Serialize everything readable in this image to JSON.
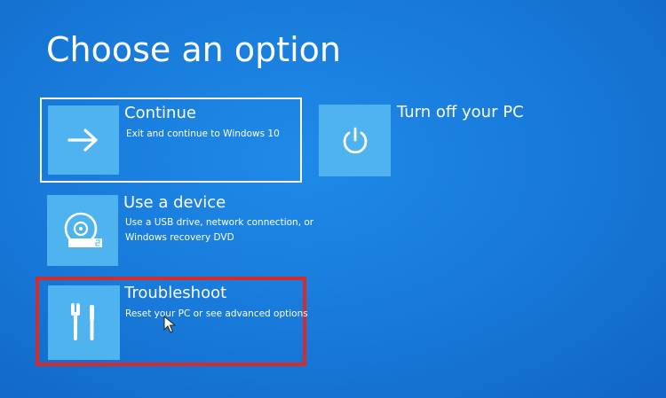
{
  "screen": {
    "title": "Choose an option",
    "background_color": "#1778d8",
    "tile_color": "#4fb3ef",
    "highlight_color": "#d42c2c"
  },
  "options": {
    "continue": {
      "title": "Continue",
      "description": "Exit and continue to Windows 10",
      "icon": "arrow-right-icon",
      "selected": true
    },
    "use_device": {
      "title": "Use a device",
      "description_line1": "Use a USB drive, network connection, or",
      "description_line2": "Windows recovery DVD",
      "icon": "disc-drive-icon"
    },
    "troubleshoot": {
      "title": "Troubleshoot",
      "description": "Reset your PC or see advanced options",
      "icon": "tools-icon",
      "highlighted": true
    },
    "turn_off": {
      "title": "Turn off your PC",
      "icon": "power-icon"
    }
  }
}
